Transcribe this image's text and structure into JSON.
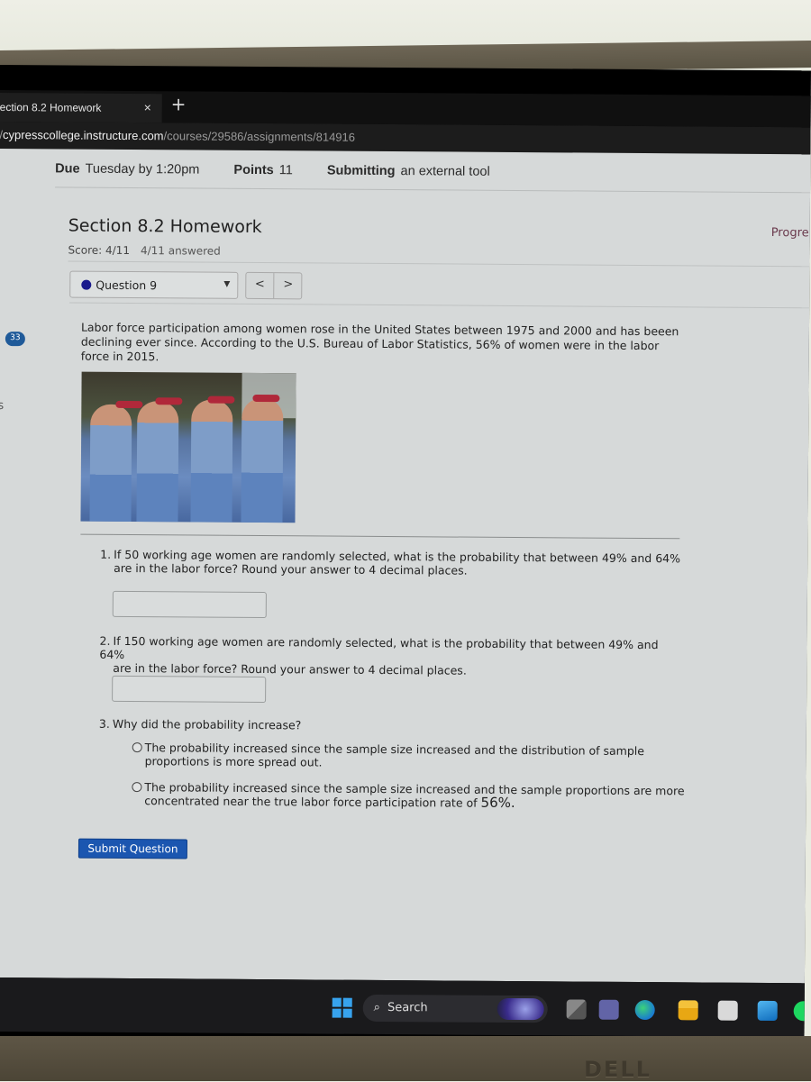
{
  "browser": {
    "tab_title": "ection 8.2 Homework",
    "close_tab_glyph": "×",
    "new_tab_glyph": "+",
    "url_prefix": "/",
    "url_host": "cypresscollege.instructure.com",
    "url_path": "/courses/29586/assignments/814916"
  },
  "assignment_meta": {
    "due_label": "Due",
    "due_value": "Tuesday by 1:20pm",
    "points_label": "Points",
    "points_value": "11",
    "submitting_label": "Submitting",
    "submitting_value": "an external tool"
  },
  "homework": {
    "title": "Section 8.2 Homework",
    "score": "Score: 4/11",
    "answered": "4/11 answered",
    "progress_label": "Progre"
  },
  "question_nav": {
    "selected": "Question 9",
    "dropdown_icon": "▼",
    "prev_glyph": "<",
    "next_glyph": ">"
  },
  "sidebar": {
    "badge_count": "33",
    "cut_letter": "s"
  },
  "question": {
    "intro": "Labor force participation among women rose in the United States between 1975 and 2000 and has beeen declining ever since. According to the U.S. Bureau of Labor Statistics, 56% of women were in the labor force in 2015.",
    "image_alt": "women dressed as Rosie the Riveter flexing arms",
    "parts": [
      {
        "number": "1.",
        "line1": "If 50 working age women are randomly selected, what is the probability that between 49% and 64%",
        "line2": "are in the labor force? Round your answer to 4 decimal places.",
        "answer_value": ""
      },
      {
        "number": "2.",
        "line1": "If 150 working age women are randomly selected, what is the probability that between 49% and 64%",
        "line2": "are in the labor force? Round your answer to 4 decimal places.",
        "answer_value": ""
      },
      {
        "number": "3.",
        "line1": "Why did the probability increase?"
      }
    ],
    "choices": [
      {
        "line1": "The probability increased since the sample size increased and the distribution of sample",
        "line2": "proportions is more spread out.",
        "selected": false
      },
      {
        "line1": "The probability increased since the sample size increased and the sample proportions are more",
        "line2": "concentrated near the true labor force participation rate of ",
        "line2_emph": "56%.",
        "selected": false
      }
    ],
    "submit_label": "Submit Question"
  },
  "taskbar": {
    "search_label": "Search",
    "search_icon": "⌕",
    "icons": [
      "windows-start",
      "task-view",
      "teams",
      "edge",
      "file-explorer",
      "microsoft-store",
      "mail",
      "spotify"
    ]
  },
  "monitor": {
    "brand": "DELL"
  },
  "colors": {
    "accent_button": "#1b56b0",
    "question_dot": "#1a1a8c",
    "badge": "#1f5a99",
    "progress_text": "#6a3a4d"
  }
}
